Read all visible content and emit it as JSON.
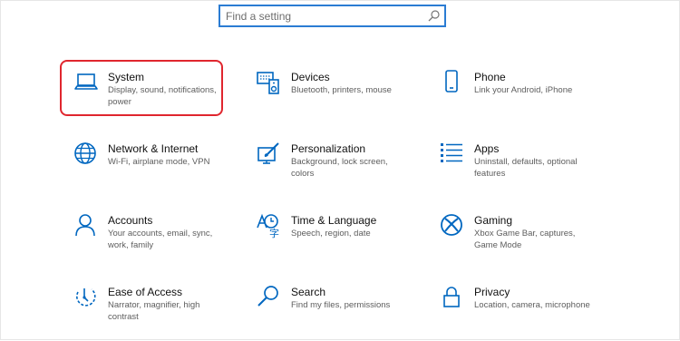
{
  "search": {
    "placeholder": "Find a setting",
    "icon": "search-icon"
  },
  "tiles": [
    {
      "title": "System",
      "desc": "Display, sound, notifications, power",
      "icon": "laptop-icon",
      "highlighted": true
    },
    {
      "title": "Devices",
      "desc": "Bluetooth, printers, mouse",
      "icon": "devices-icon"
    },
    {
      "title": "Phone",
      "desc": "Link your Android, iPhone",
      "icon": "phone-icon"
    },
    {
      "title": "Network & Internet",
      "desc": "Wi-Fi, airplane mode, VPN",
      "icon": "globe-icon"
    },
    {
      "title": "Personalization",
      "desc": "Background, lock screen, colors",
      "icon": "paintbrush-icon"
    },
    {
      "title": "Apps",
      "desc": "Uninstall, defaults, optional features",
      "icon": "apps-list-icon"
    },
    {
      "title": "Accounts",
      "desc": "Your accounts, email, sync, work, family",
      "icon": "person-icon"
    },
    {
      "title": "Time & Language",
      "desc": "Speech, region, date",
      "icon": "time-language-icon"
    },
    {
      "title": "Gaming",
      "desc": "Xbox Game Bar, captures, Game Mode",
      "icon": "xbox-icon"
    },
    {
      "title": "Ease of Access",
      "desc": "Narrator, magnifier, high contrast",
      "icon": "ease-of-access-icon"
    },
    {
      "title": "Search",
      "desc": "Find my files, permissions",
      "icon": "search-icon"
    },
    {
      "title": "Privacy",
      "desc": "Location, camera, microphone",
      "icon": "lock-icon"
    }
  ],
  "colors": {
    "accent": "#0067c0",
    "highlight": "#e0262e",
    "search_border": "#2b7cd3"
  }
}
